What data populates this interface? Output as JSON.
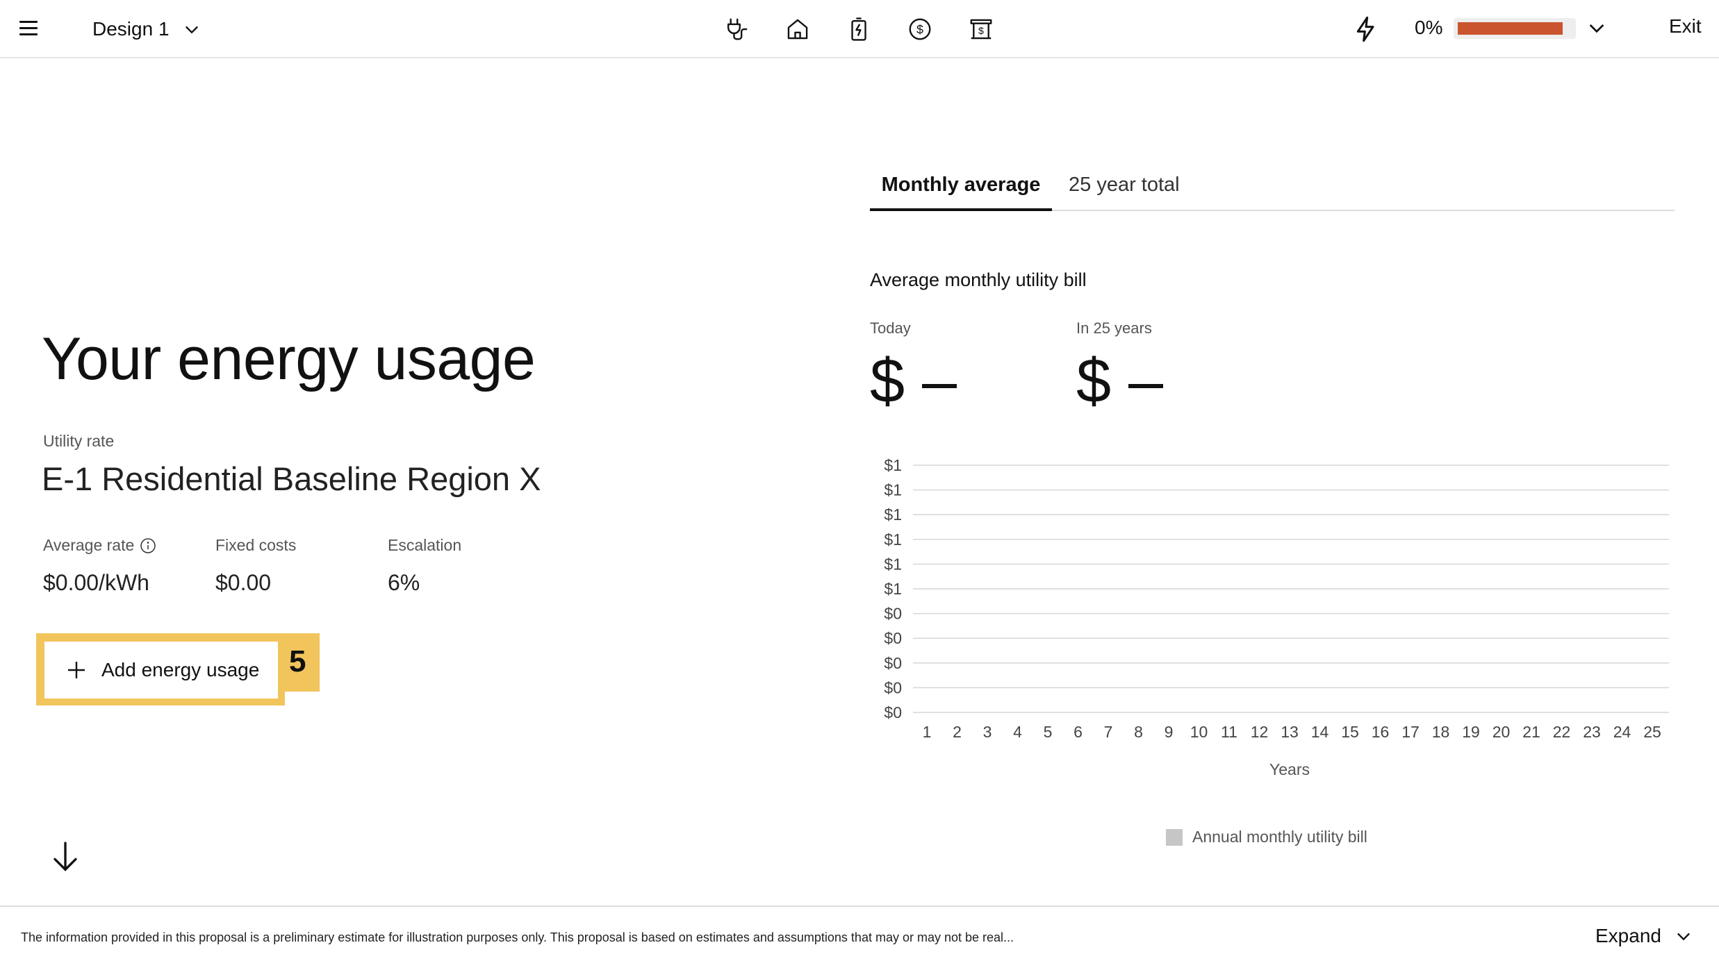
{
  "header": {
    "design_label": "Design 1",
    "nav_icons": [
      "plug-icon",
      "home-icon",
      "battery-charging-icon",
      "dollar-circle-icon",
      "bank-icon"
    ],
    "progress_text": "0%",
    "progress_fraction": 0.92,
    "progress_color": "#c9542d",
    "exit_label": "Exit"
  },
  "main": {
    "title": "Your energy usage",
    "utility_rate_label": "Utility rate",
    "utility_rate_value": "E-1 Residential Baseline Region X",
    "metrics": [
      {
        "label": "Average rate",
        "value": "$0.00/kWh"
      },
      {
        "label": "Fixed costs",
        "value": "$0.00"
      },
      {
        "label": "Escalation",
        "value": "6%"
      }
    ],
    "add_button_label": "Add energy usage",
    "step_badge": "5",
    "highlight_color": "#f2c45c"
  },
  "right": {
    "tabs": [
      {
        "label": "Monthly average",
        "active": true
      },
      {
        "label": "25 year total",
        "active": false
      }
    ],
    "bill_title": "Average monthly utility bill",
    "today_label": "Today",
    "today_value": "$ –",
    "future_label": "In 25 years",
    "future_value": "$ –",
    "legend_label": "Annual monthly utility bill"
  },
  "chart_data": {
    "type": "bar",
    "title": "",
    "xlabel": "Years",
    "ylabel": "",
    "categories": [
      "1",
      "2",
      "3",
      "4",
      "5",
      "6",
      "7",
      "8",
      "9",
      "10",
      "11",
      "12",
      "13",
      "14",
      "15",
      "16",
      "17",
      "18",
      "19",
      "20",
      "21",
      "22",
      "23",
      "24",
      "25"
    ],
    "y_tick_labels": [
      "$1",
      "$1",
      "$1",
      "$1",
      "$1",
      "$1",
      "$0",
      "$0",
      "$0",
      "$0",
      "$0"
    ],
    "series": [
      {
        "name": "Annual monthly utility bill",
        "values": [
          0,
          0,
          0,
          0,
          0,
          0,
          0,
          0,
          0,
          0,
          0,
          0,
          0,
          0,
          0,
          0,
          0,
          0,
          0,
          0,
          0,
          0,
          0,
          0,
          0
        ]
      }
    ],
    "grid": true,
    "legend": "bottom-center"
  },
  "footer": {
    "disclaimer": "The information provided in this proposal is a preliminary estimate for illustration purposes only. This proposal is based on estimates and assumptions that may or may not be real...",
    "expand_label": "Expand"
  }
}
